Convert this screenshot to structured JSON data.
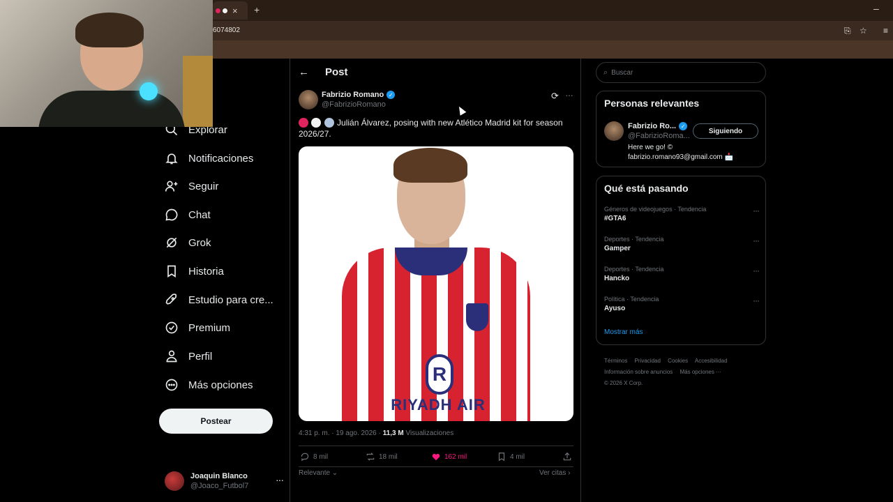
{
  "browser": {
    "url": "6074802",
    "new_tab_symbol": "+",
    "close_symbol": "×",
    "minimize_symbol": "–",
    "tab_dot_colors": [
      "#e0245e",
      "#f4f4f4"
    ]
  },
  "nav": {
    "items": [
      {
        "label": "Explorar",
        "icon": "search-icon"
      },
      {
        "label": "Notificaciones",
        "icon": "bell-icon"
      },
      {
        "label": "Seguir",
        "icon": "person-plus-icon"
      },
      {
        "label": "Chat",
        "icon": "chat-bubble-icon"
      },
      {
        "label": "Grok",
        "icon": "grok-icon"
      },
      {
        "label": "Historia",
        "icon": "bookmark-icon"
      },
      {
        "label": "Estudio para cre...",
        "icon": "rocket-icon"
      },
      {
        "label": "Premium",
        "icon": "badge-check-icon"
      },
      {
        "label": "Perfil",
        "icon": "person-icon"
      },
      {
        "label": "Más opciones",
        "icon": "more-circle-icon"
      }
    ],
    "post_button": "Postear",
    "account": {
      "name": "Joaquin Blanco",
      "handle": "@Joaco_Futbol7"
    }
  },
  "main": {
    "title": "Post",
    "post": {
      "author_name": "Fabrizio Romano",
      "author_handle": "@FabrizioRomano",
      "text": "Julián Álvarez, posing with new Atlético Madrid kit for season 2026/27.",
      "image_sponsor": "RIYADH AIR",
      "timestamp": "4:31 p. m. · 19 ago. 2026 · ",
      "views_count": "11,3 M",
      "views_label": " Visualizaciones",
      "replies": "8 mil",
      "reposts": "18 mil",
      "likes": "162 mil",
      "bookmarks": "4 mil",
      "sort_label": "Relevante",
      "quotes_link": "Ver citas"
    }
  },
  "right": {
    "search_placeholder": "Buscar",
    "relevant": {
      "title": "Personas relevantes",
      "name": "Fabrizio Ro...",
      "handle": "@FabrizioRoma...",
      "follow_button": "Siguiendo",
      "bio": "Here we go! © fabrizio.romano93@gmail.com 📩"
    },
    "trending": {
      "title": "Qué está pasando",
      "items": [
        {
          "category": "Géneros de videojuegos · Tendencia",
          "name": "#GTA6"
        },
        {
          "category": "Deportes · Tendencia",
          "name": "Gamper"
        },
        {
          "category": "Deportes · Tendencia",
          "name": "Hancko"
        },
        {
          "category": "Política · Tendencia",
          "name": "Ayuso"
        }
      ],
      "show_more": "Mostrar más"
    },
    "footer": {
      "links": [
        "Términos",
        "Privacidad",
        "Cookies",
        "Accesibilidad",
        "Información sobre anuncios",
        "Más opciones ···"
      ],
      "copyright": "© 2026 X Corp."
    }
  },
  "colors": {
    "accent": "#1d9bf0",
    "like": "#f91880",
    "background": "#000000"
  }
}
